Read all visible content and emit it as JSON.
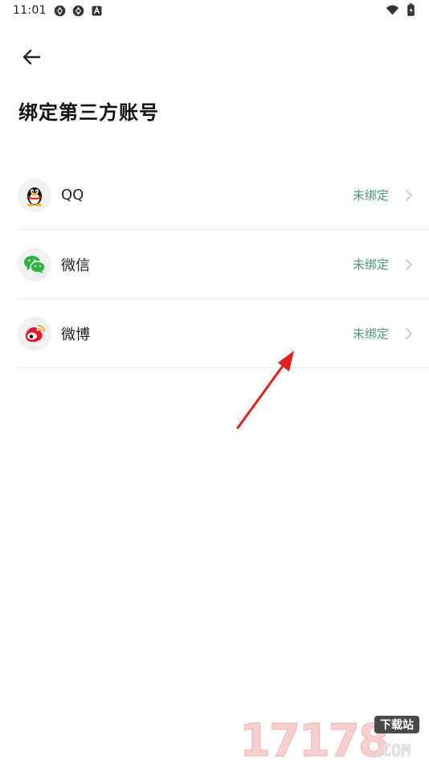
{
  "status_bar": {
    "time": "11:01",
    "left_icons": [
      "sync-icon",
      "sync-icon",
      "a-icon"
    ],
    "right_icons": [
      "wifi-icon",
      "battery-icon"
    ]
  },
  "header": {
    "back_icon": "arrow-left-icon",
    "title": "绑定第三方账号"
  },
  "accounts": [
    {
      "name": "QQ",
      "status": "未绑定",
      "icon": "qq-penguin-icon"
    },
    {
      "name": "微信",
      "status": "未绑定",
      "icon": "wechat-icon"
    },
    {
      "name": "微博",
      "status": "未绑定",
      "icon": "weibo-icon"
    }
  ],
  "colors": {
    "status_text": "#4a9b72",
    "annotation_arrow": "#e02020"
  },
  "watermark": {
    "numerals": "17178",
    "badge": "下载站",
    "suffix": ".COM"
  }
}
